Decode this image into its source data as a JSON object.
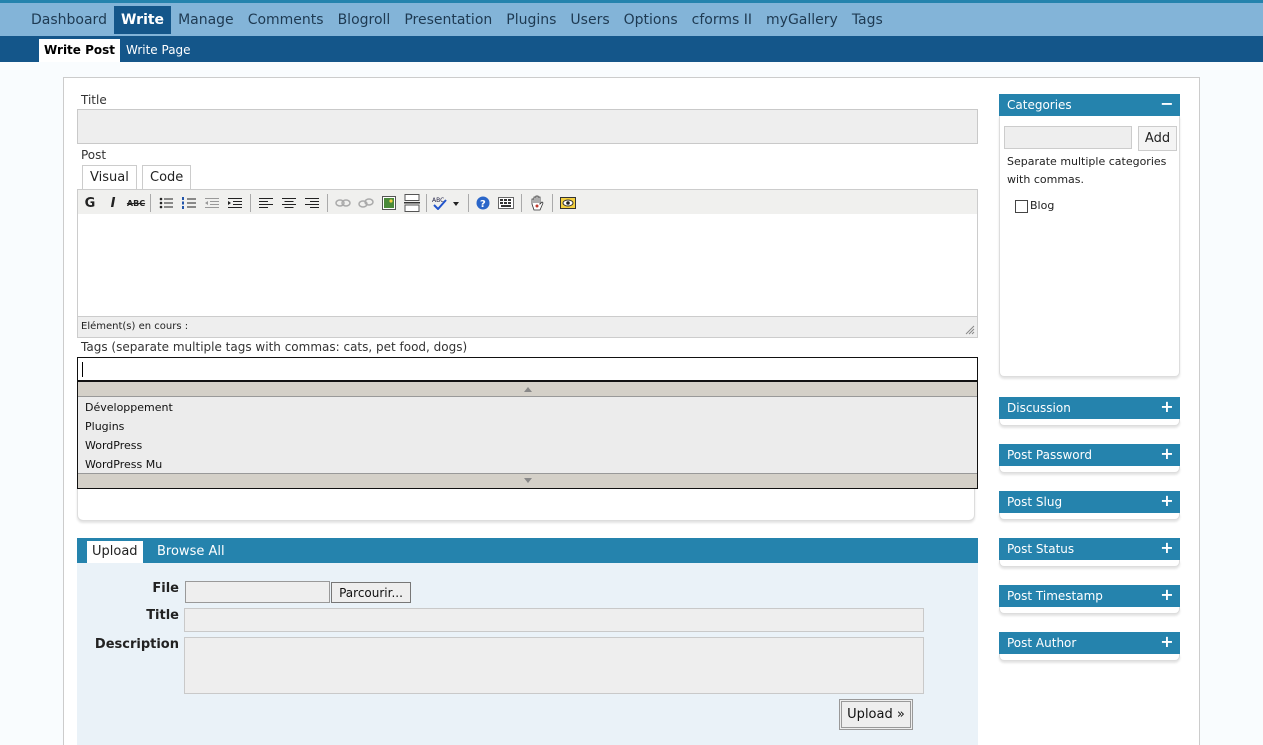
{
  "nav": {
    "items": [
      "Dashboard",
      "Write",
      "Manage",
      "Comments",
      "Blogroll",
      "Presentation",
      "Plugins",
      "Users",
      "Options",
      "cforms II",
      "myGallery",
      "Tags"
    ],
    "active_index": 1
  },
  "subnav": {
    "active": "Write Post",
    "other": "Write Page"
  },
  "form": {
    "title_label": "Title",
    "post_label": "Post",
    "tab_visual": "Visual",
    "tab_code": "Code",
    "toolbar_bold": "G",
    "toolbar_italic": "I",
    "toolbar_strike": "ABC",
    "status_text": "Elément(s) en cours :",
    "tags_label": "Tags (separate multiple tags with commas: cats, pet food, dogs)"
  },
  "tag_suggestions": [
    "Développement",
    "Plugins",
    "WordPress",
    "WordPress Mu"
  ],
  "upload": {
    "tab_upload": "Upload",
    "tab_browse": "Browse All",
    "file_label": "File",
    "browse_button": "Parcourir...",
    "title_label": "Title",
    "description_label": "Description",
    "submit_label": "Upload »"
  },
  "sidebar": {
    "categories": {
      "title": "Categories",
      "add_label": "Add",
      "help": "Separate multiple categories with commas.",
      "items": [
        "Blog"
      ]
    },
    "boxes": [
      "Discussion",
      "Post Password",
      "Post Slug",
      "Post Status",
      "Post Timestamp",
      "Post Author"
    ]
  },
  "colors": {
    "header_blue": "#83b4d8",
    "dark_blue": "#14568a",
    "box_blue": "#2583ad"
  }
}
